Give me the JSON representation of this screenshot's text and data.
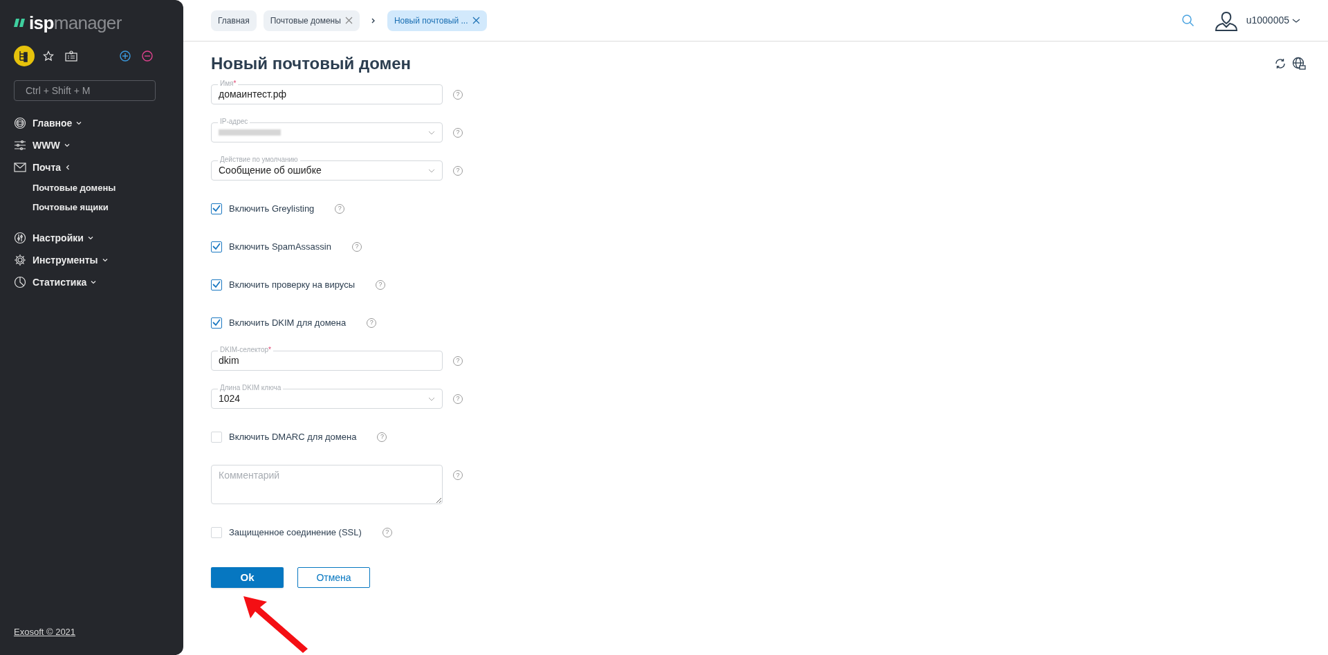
{
  "logo": {
    "prefix": "isp",
    "suffix": "manager"
  },
  "sidebar": {
    "search": {
      "placeholder": "Ctrl + Shift + M"
    },
    "items": [
      {
        "label": "Главное",
        "expanded": false
      },
      {
        "label": "WWW",
        "expanded": false
      },
      {
        "label": "Почта",
        "expanded": true,
        "children": [
          {
            "label": "Почтовые домены"
          },
          {
            "label": "Почтовые ящики"
          }
        ]
      },
      {
        "label": "Настройки",
        "expanded": false
      },
      {
        "label": "Инструменты",
        "expanded": false
      },
      {
        "label": "Статистика",
        "expanded": false
      }
    ],
    "footer": "Exosoft © 2021"
  },
  "breadcrumbs": [
    {
      "label": "Главная",
      "selected": false,
      "closable": false
    },
    {
      "label": "Почтовые домены",
      "selected": false,
      "closable": true
    },
    {
      "label": "Новый почтовый ...",
      "selected": true,
      "closable": true
    }
  ],
  "user": {
    "name": "u1000005"
  },
  "title": "Новый почтовый домен",
  "form": [
    {
      "kind": "text",
      "label": "Имя",
      "required_mark": "*",
      "value": "домаинтест.рф",
      "help": "?"
    },
    {
      "kind": "select",
      "label": "IP-адрес",
      "value_redacted": true,
      "help": "?"
    },
    {
      "kind": "select",
      "label": "Действие по умолчанию",
      "value": "Сообщение об ошибке",
      "help": "?"
    },
    {
      "kind": "checkbox",
      "label": "Включить Greylisting",
      "checked": true,
      "help": "?"
    },
    {
      "kind": "checkbox",
      "label": "Включить SpamAssassin",
      "checked": true,
      "help": "?"
    },
    {
      "kind": "checkbox",
      "label": "Включить проверку на вирусы",
      "checked": true,
      "help": "?"
    },
    {
      "kind": "checkbox",
      "label": "Включить DKIM для домена",
      "checked": true,
      "help": "?"
    },
    {
      "kind": "text",
      "label": "DKIM-селектор",
      "required_mark": "*",
      "value": "dkim",
      "help": "?"
    },
    {
      "kind": "select",
      "label": "Длина DKIM ключа",
      "value": "1024",
      "help": "?"
    },
    {
      "kind": "checkbox",
      "label": "Включить DMARC для домена",
      "checked": false,
      "help": "?"
    },
    {
      "kind": "textarea",
      "placeholder": "Комментарий",
      "help": "?"
    },
    {
      "kind": "checkbox",
      "label": "Защищенное соединение (SSL)",
      "checked": false,
      "help": "?"
    }
  ],
  "buttons": [
    {
      "label": "Ok",
      "kind": "primary"
    },
    {
      "label": "Отмена",
      "kind": "secondary"
    }
  ],
  "annotation": {
    "kind": "arrow"
  }
}
